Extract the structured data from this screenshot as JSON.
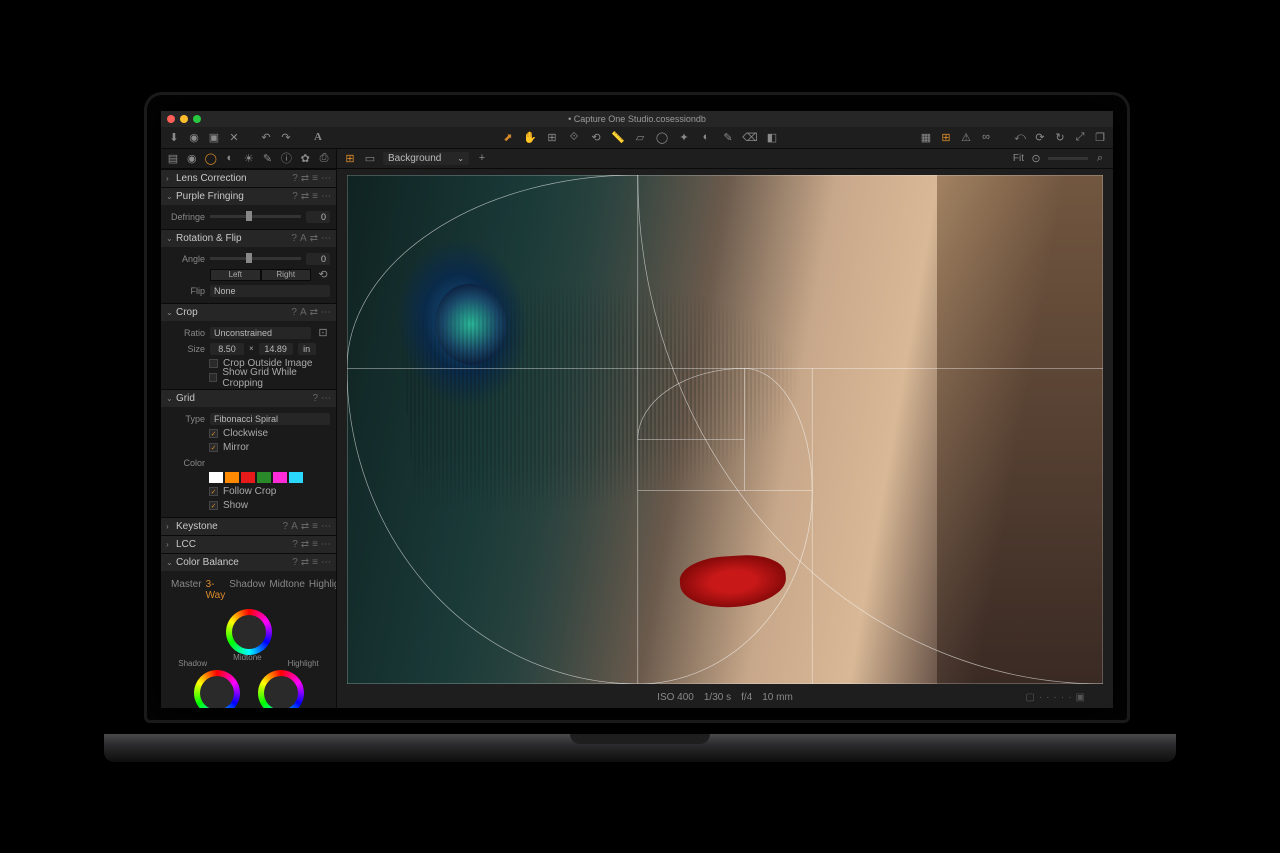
{
  "window": {
    "title": "• Capture One Studio.cosessiondb"
  },
  "toolbar": {
    "left_icons": [
      "import",
      "camera",
      "folder",
      "clear",
      "undo",
      "redo",
      "text"
    ],
    "center_icons": [
      "cursor",
      "hand",
      "pan",
      "zoom",
      "crop",
      "rotate",
      "straighten",
      "keystone",
      "spot",
      "mask",
      "brush",
      "erase",
      "gradient"
    ],
    "right_icons": [
      "focus",
      "grid",
      "warn",
      "view",
      "rotate-ccw",
      "reset",
      "rotate-cw",
      "expand",
      "proof"
    ]
  },
  "side_tabs": [
    "library",
    "tether",
    "lens",
    "color",
    "exposure",
    "adjust",
    "meta",
    "settings",
    "output"
  ],
  "panels": {
    "lens": {
      "title": "Lens Correction",
      "open": false
    },
    "purple": {
      "title": "Purple Fringing",
      "open": true,
      "defringe_label": "Defringe",
      "defringe_value": "0"
    },
    "rotation": {
      "title": "Rotation & Flip",
      "open": true,
      "angle_label": "Angle",
      "angle_value": "0",
      "left": "Left",
      "right": "Right",
      "flip_label": "Flip",
      "flip_value": "None"
    },
    "crop": {
      "title": "Crop",
      "open": true,
      "ratio_label": "Ratio",
      "ratio_value": "Unconstrained",
      "size_label": "Size",
      "size_w": "8.50",
      "size_x": "×",
      "size_h": "14.89",
      "size_unit": "in",
      "opt1": "Crop Outside Image",
      "opt2": "Show Grid While Cropping"
    },
    "grid": {
      "title": "Grid",
      "open": true,
      "type_label": "Type",
      "type_value": "Fibonacci Spiral",
      "clockwise": "Clockwise",
      "mirror": "Mirror",
      "color_label": "Color",
      "follow": "Follow Crop",
      "show": "Show",
      "colors": [
        "#ffffff",
        "#ff8a00",
        "#e81a1a",
        "#2a8a2a",
        "#ff2ad8",
        "#2ad8ff"
      ]
    },
    "keystone": {
      "title": "Keystone",
      "open": false
    },
    "lcc": {
      "title": "LCC",
      "open": false
    },
    "colorbalance": {
      "title": "Color Balance",
      "open": true,
      "tabs": [
        "Master",
        "3-Way",
        "Shadow",
        "Midtone",
        "Highlight"
      ],
      "active": "3-Way",
      "shadow": "Shadow",
      "mid": "Midtone",
      "high": "Highlight"
    }
  },
  "hdr_tools": {
    "q": "?",
    "a": "A",
    "more": "⋯",
    "copy": "⇄",
    "menu": "≡"
  },
  "main": {
    "grid_icon": "grid",
    "layer_label": "Background",
    "plus": "+",
    "fit": "Fit",
    "zoom": "⊙",
    "search": "⌕",
    "meta": {
      "iso": "ISO 400",
      "shutter": "1/30 s",
      "aperture": "f/4",
      "focal": "10 mm"
    }
  }
}
